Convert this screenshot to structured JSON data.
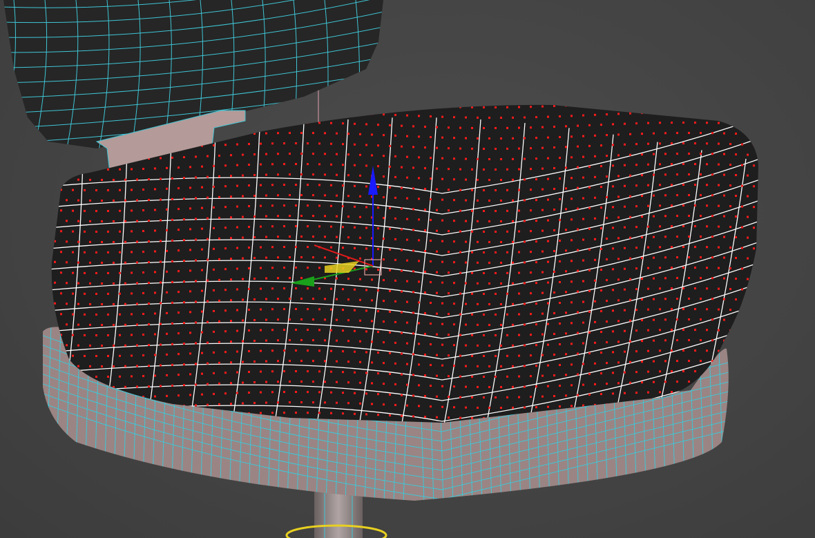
{
  "viewport": {
    "background_color": "#444444",
    "wireframe_color": "#3fc6d6",
    "selected_edge_color": "#ffffff",
    "vertex_color": "#ff1a1a",
    "mesh_fill_color": "#1e1e1e",
    "base_fill_color": "#9a8584",
    "gizmo": {
      "z_axis_color": "#1a1aff",
      "y_axis_color": "#1aa01a",
      "x_axis_color": "#e01a1a",
      "plane_color": "#e8d020"
    },
    "icons": [
      "move-gizmo-icon"
    ]
  }
}
